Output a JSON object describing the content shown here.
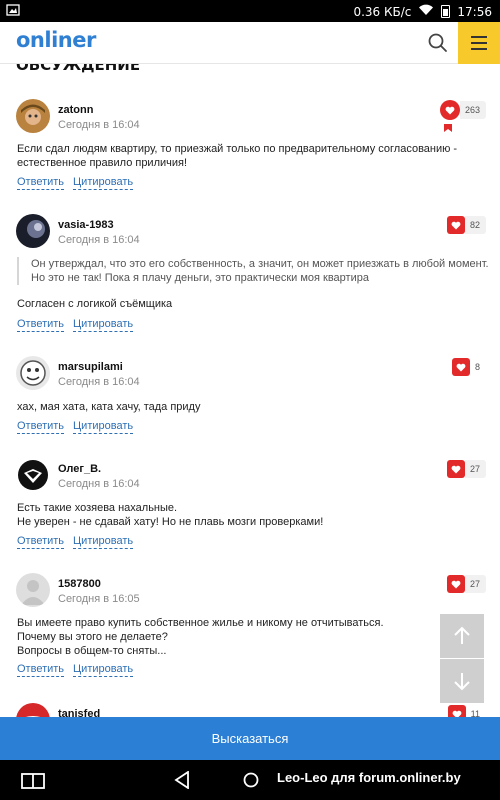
{
  "status_bar": {
    "speed": "0.36 КБ/с",
    "time": "17:56"
  },
  "header": {
    "logo": "onliner"
  },
  "section_title": "ОБСУЖДЕНИЕ",
  "comments": [
    {
      "author": "zatonn",
      "time": "Сегодня в 16:04",
      "likes": "263",
      "text": "Если сдал людям квартиру, то приезжай только по предварительному согласованию -\nестественное правило приличия!",
      "reply": "Ответить",
      "cite": "Цитировать"
    },
    {
      "author": "vasia-1983",
      "time": "Сегодня в 16:04",
      "likes": "82",
      "quote": "Он утверждал, что это его собственность, а значит, он может приезжать в любой момент.\nНо это не так! Пока я плачу деньги, это практически моя квартира",
      "text": "Согласен с логикой съёмщика",
      "reply": "Ответить",
      "cite": "Цитировать"
    },
    {
      "author": "marsupilami",
      "time": "Сегодня в 16:04",
      "likes": "8",
      "text": "хах, мая хата, ката хачу, тада приду",
      "reply": "Ответить",
      "cite": "Цитировать"
    },
    {
      "author": "Олег_В.",
      "time": "Сегодня в 16:04",
      "likes": "27",
      "text": "Есть такие хозяева нахальные.\nНе уверен - не сдавай хату! Но не плавь мозги проверками!",
      "reply": "Ответить",
      "cite": "Цитировать"
    },
    {
      "author": "1587800",
      "time": "Сегодня в 16:05",
      "likes": "27",
      "text": "Вы имеете право купить собственное жилье и никому не отчитываться.\nПочему вы этого не делаете?\nВопросы в общем-то сняты...",
      "reply": "Ответить",
      "cite": "Цитировать"
    },
    {
      "author": "tanisfed",
      "likes": "11"
    }
  ],
  "cta_label": "Высказаться",
  "nav_bar": {
    "caption": "Leo-Leo для forum.onliner.by"
  }
}
